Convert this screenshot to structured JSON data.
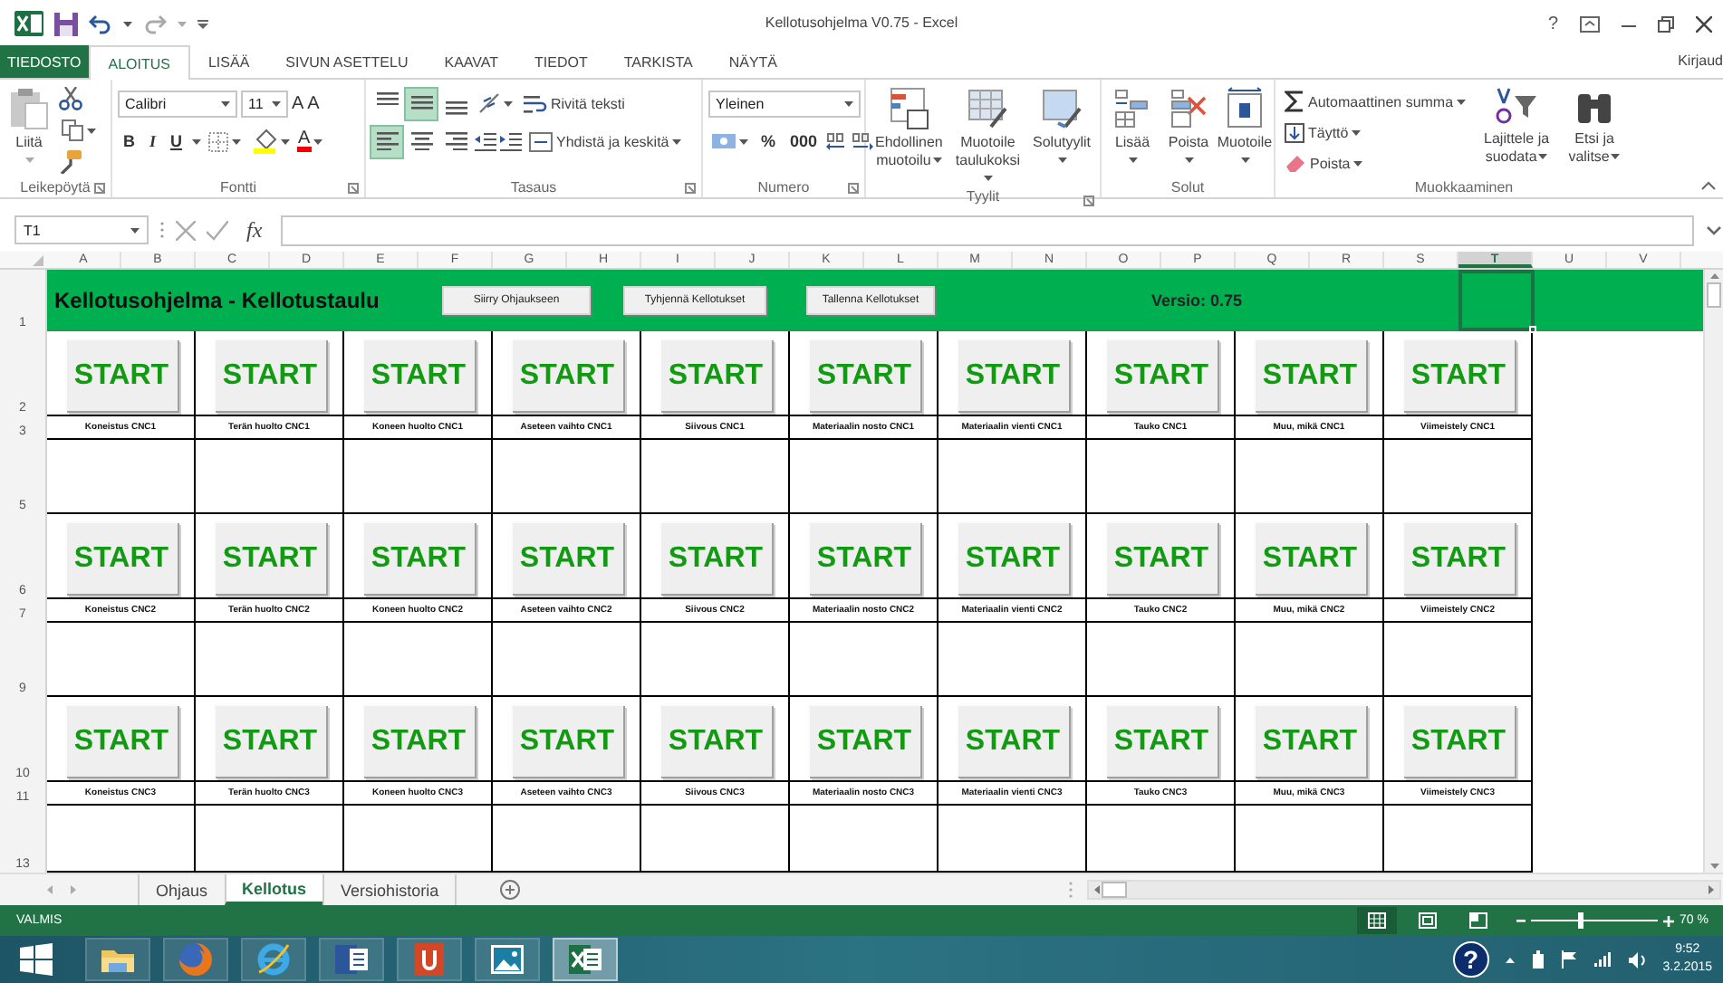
{
  "window": {
    "title": "Kellotusohjelma V0.75 - Excel",
    "help": "?",
    "account": "Kirjaud"
  },
  "ribbon_tabs": [
    {
      "label": "TIEDOSTO",
      "kind": "file",
      "selected": false
    },
    {
      "label": "ALOITUS",
      "kind": "tab",
      "selected": true
    },
    {
      "label": "LISÄÄ",
      "kind": "tab",
      "selected": false
    },
    {
      "label": "SIVUN ASETTELU",
      "kind": "tab",
      "selected": false
    },
    {
      "label": "KAAVAT",
      "kind": "tab",
      "selected": false
    },
    {
      "label": "TIEDOT",
      "kind": "tab",
      "selected": false
    },
    {
      "label": "TARKISTA",
      "kind": "tab",
      "selected": false
    },
    {
      "label": "NÄYTÄ",
      "kind": "tab",
      "selected": false
    }
  ],
  "ribbon": {
    "clipboard": {
      "label": "Leikepöytä",
      "paste": "Liitä"
    },
    "font": {
      "label": "Fontti",
      "name": "Calibri",
      "size": "11",
      "grow": "A",
      "shrink": "A",
      "bold": "B",
      "italic": "I",
      "underline": "U",
      "color_letter": "A"
    },
    "alignment": {
      "label": "Tasaus",
      "buttons": [
        {
          "kind": "top",
          "selected": false
        },
        {
          "kind": "middle",
          "selected": true
        },
        {
          "kind": "bottom",
          "selected": false
        },
        {
          "kind": "left",
          "selected": true
        },
        {
          "kind": "center",
          "selected": false
        },
        {
          "kind": "right",
          "selected": false
        }
      ],
      "wrap": "Rivitä teksti",
      "merge": "Yhdistä ja keskitä"
    },
    "number": {
      "label": "Numero",
      "format": "Yleinen",
      "percent": "%",
      "thousands": "000"
    },
    "styles": {
      "label": "Tyylit",
      "buttons": [
        "Ehdollinen muotoilu",
        "Muotoile taulukoksi",
        "Solutyylit"
      ]
    },
    "cells": {
      "label": "Solut",
      "buttons": [
        "Lisää",
        "Poista",
        "Muotoile"
      ]
    },
    "editing": {
      "label": "Muokkaaminen",
      "autosum": "Automaattinen summa",
      "fill": "Täyttö",
      "clear": "Poista",
      "sort": "Lajittele ja suodata",
      "find": "Etsi ja valitse"
    }
  },
  "formula_bar": {
    "name_box": "T1",
    "function_label": "fx"
  },
  "column_headers": [
    {
      "label": "A",
      "selected": false
    },
    {
      "label": "B",
      "selected": false
    },
    {
      "label": "C",
      "selected": false
    },
    {
      "label": "D",
      "selected": false
    },
    {
      "label": "E",
      "selected": false
    },
    {
      "label": "F",
      "selected": false
    },
    {
      "label": "G",
      "selected": false
    },
    {
      "label": "H",
      "selected": false
    },
    {
      "label": "I",
      "selected": false
    },
    {
      "label": "J",
      "selected": false
    },
    {
      "label": "K",
      "selected": false
    },
    {
      "label": "L",
      "selected": false
    },
    {
      "label": "M",
      "selected": false
    },
    {
      "label": "N",
      "selected": false
    },
    {
      "label": "O",
      "selected": false
    },
    {
      "label": "P",
      "selected": false
    },
    {
      "label": "Q",
      "selected": false
    },
    {
      "label": "R",
      "selected": false
    },
    {
      "label": "S",
      "selected": false
    },
    {
      "label": "T",
      "selected": true
    },
    {
      "label": "U",
      "selected": false
    },
    {
      "label": "V",
      "selected": false
    }
  ],
  "sheet_header": {
    "row": "1",
    "title": "Kellotusohjelma - Kellotustaulu",
    "buttons": [
      "Siirry Ohjaukseen",
      "Tyhjennä Kellotukset",
      "Tallenna Kellotukset"
    ],
    "version": "Versio: 0.75"
  },
  "blocks": [
    {
      "rows": [
        "2",
        "3",
        "5"
      ],
      "cells": [
        {
          "button": "START",
          "label": "Koneistus CNC1"
        },
        {
          "button": "START",
          "label": "Terän huolto CNC1"
        },
        {
          "button": "START",
          "label": "Koneen huolto CNC1"
        },
        {
          "button": "START",
          "label": "Aseteen vaihto CNC1"
        },
        {
          "button": "START",
          "label": "Siivous CNC1"
        },
        {
          "button": "START",
          "label": "Materiaalin nosto CNC1"
        },
        {
          "button": "START",
          "label": "Materiaalin vienti CNC1"
        },
        {
          "button": "START",
          "label": "Tauko CNC1"
        },
        {
          "button": "START",
          "label": "Muu, mikä CNC1"
        },
        {
          "button": "START",
          "label": "Viimeistely CNC1"
        }
      ]
    },
    {
      "rows": [
        "6",
        "7",
        "9"
      ],
      "cells": [
        {
          "button": "START",
          "label": "Koneistus CNC2"
        },
        {
          "button": "START",
          "label": "Terän huolto CNC2"
        },
        {
          "button": "START",
          "label": "Koneen huolto CNC2"
        },
        {
          "button": "START",
          "label": "Aseteen vaihto CNC2"
        },
        {
          "button": "START",
          "label": "Siivous CNC2"
        },
        {
          "button": "START",
          "label": "Materiaalin nosto CNC2"
        },
        {
          "button": "START",
          "label": "Materiaalin vienti CNC2"
        },
        {
          "button": "START",
          "label": "Tauko CNC2"
        },
        {
          "button": "START",
          "label": "Muu, mikä CNC2"
        },
        {
          "button": "START",
          "label": "Viimeistely CNC2"
        }
      ]
    },
    {
      "rows": [
        "10",
        "11",
        "13"
      ],
      "cells": [
        {
          "button": "START",
          "label": "Koneistus CNC3"
        },
        {
          "button": "START",
          "label": "Terän huolto CNC3"
        },
        {
          "button": "START",
          "label": "Koneen huolto CNC3"
        },
        {
          "button": "START",
          "label": "Aseteen vaihto CNC3"
        },
        {
          "button": "START",
          "label": "Siivous CNC3"
        },
        {
          "button": "START",
          "label": "Materiaalin nosto CNC3"
        },
        {
          "button": "START",
          "label": "Materiaalin vienti CNC3"
        },
        {
          "button": "START",
          "label": "Tauko CNC3"
        },
        {
          "button": "START",
          "label": "Muu, mikä CNC3"
        },
        {
          "button": "START",
          "label": "Viimeistely CNC3"
        }
      ]
    }
  ],
  "sheet_tabs": [
    {
      "label": "Ohjaus",
      "selected": false
    },
    {
      "label": "Kellotus",
      "selected": true
    },
    {
      "label": "Versiohistoria",
      "selected": false
    }
  ],
  "status_bar": {
    "text": "VALMIS",
    "views": [
      {
        "kind": "normal",
        "selected": true
      },
      {
        "kind": "page_layout",
        "selected": false
      },
      {
        "kind": "page_break",
        "selected": false
      }
    ],
    "zoom": {
      "level": 0.38,
      "reading": "70 %"
    }
  },
  "taskbar": {
    "apps": [
      {
        "kind": "explorer",
        "selected": false
      },
      {
        "kind": "firefox",
        "selected": false
      },
      {
        "kind": "ie",
        "selected": false
      },
      {
        "kind": "word",
        "selected": false
      },
      {
        "kind": "pdf",
        "selected": false
      },
      {
        "kind": "photos",
        "selected": false
      },
      {
        "kind": "excel",
        "selected": true
      }
    ],
    "help": "?",
    "time": "9:52",
    "date": "3.2.2015"
  }
}
